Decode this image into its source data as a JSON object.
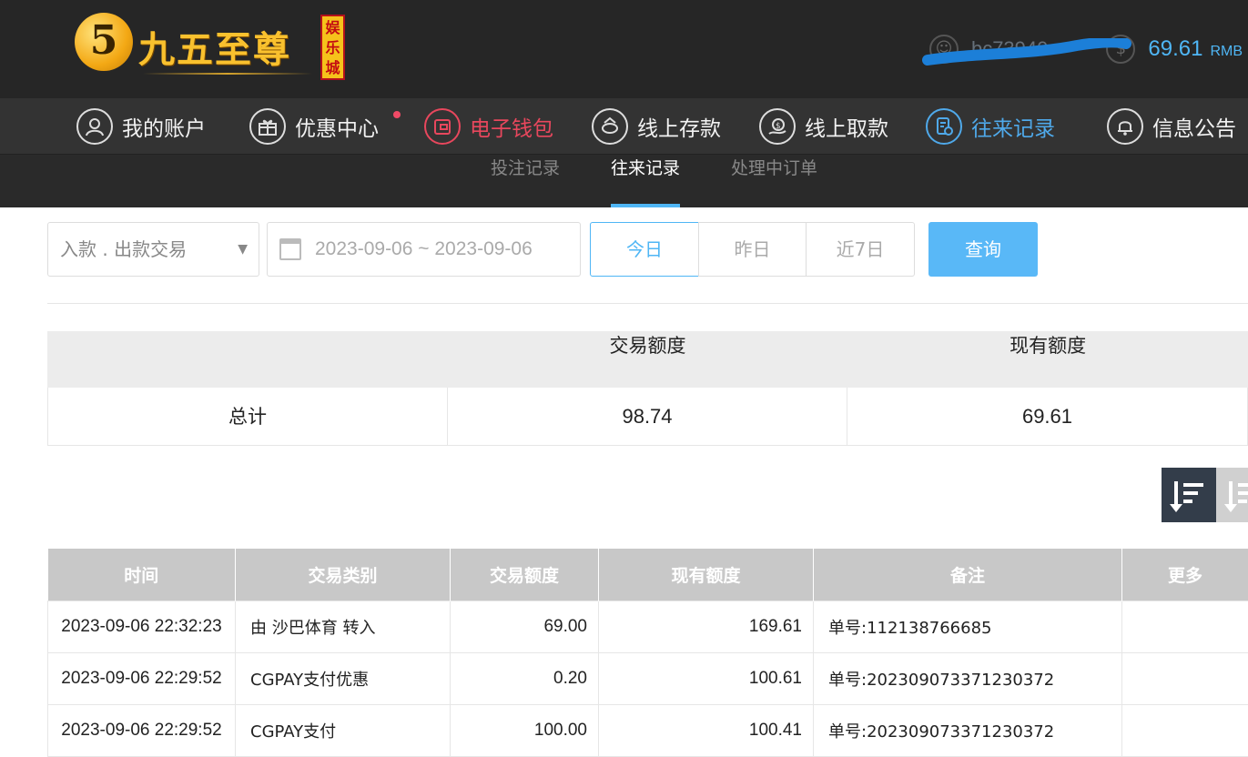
{
  "header": {
    "logo_mark": "5",
    "logo_text": "九五至尊",
    "logo_tag": "娱乐城",
    "username": "bc73940",
    "balance": "69.61",
    "currency": "RMB"
  },
  "nav": {
    "items": [
      {
        "label": "我的账户",
        "icon": "user-icon"
      },
      {
        "label": "优惠中心",
        "icon": "gift-icon"
      },
      {
        "label": "电子钱包",
        "icon": "wallet-icon"
      },
      {
        "label": "线上存款",
        "icon": "deposit-icon"
      },
      {
        "label": "线上取款",
        "icon": "withdraw-icon"
      },
      {
        "label": "往来记录",
        "icon": "records-icon"
      },
      {
        "label": "信息公告",
        "icon": "bell-icon"
      }
    ]
  },
  "subnav": {
    "items": [
      {
        "label": "投注记录"
      },
      {
        "label": "往来记录"
      },
      {
        "label": "处理中订单"
      }
    ]
  },
  "filters": {
    "type_select": "入款 . 出款交易",
    "date_range": "2023-09-06 ~ 2023-09-06",
    "today": "今日",
    "yesterday": "昨日",
    "last7": "近7日",
    "query": "查询"
  },
  "summary": {
    "head_amount": "交易额度",
    "head_balance": "现有额度",
    "row_label": "总计",
    "amount": "98.74",
    "balance": "69.61"
  },
  "table": {
    "headers": [
      "时间",
      "交易类别",
      "交易额度",
      "现有额度",
      "备注",
      "更多"
    ],
    "rows": [
      {
        "time": "2023-09-06 22:32:23",
        "type": "由 沙巴体育 转入",
        "amount": "69.00",
        "balance": "169.61",
        "note": "单号:112138766685"
      },
      {
        "time": "2023-09-06 22:29:52",
        "type": "CGPAY支付优惠",
        "amount": "0.20",
        "balance": "100.61",
        "note": "单号:202309073371230372"
      },
      {
        "time": "2023-09-06 22:29:52",
        "type": "CGPAY支付",
        "amount": "100.00",
        "balance": "100.41",
        "note": "单号:202309073371230372"
      }
    ]
  },
  "colors": {
    "accent": "#4fb6f5",
    "wallet_red": "#e8475d",
    "header_bg": "#262626",
    "nav_bg": "#333333"
  }
}
